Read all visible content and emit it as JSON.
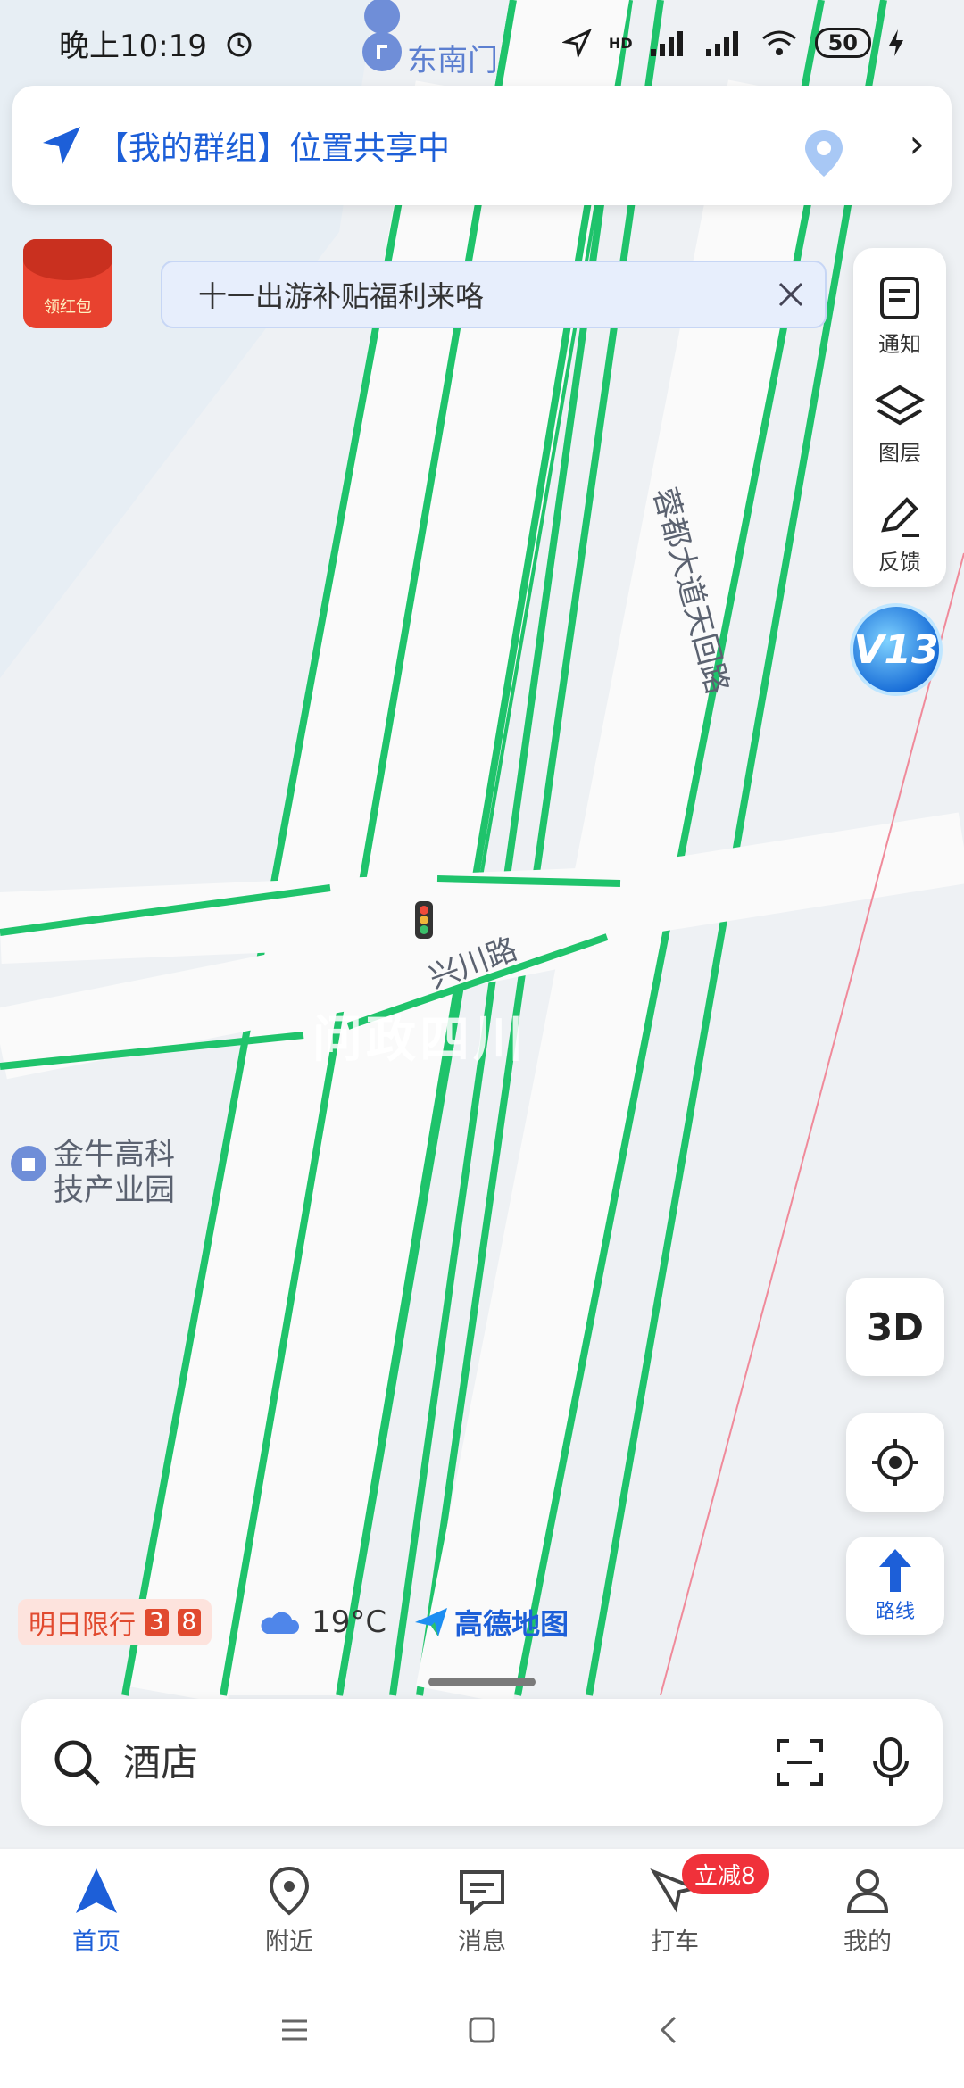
{
  "status_bar": {
    "time": "晚上10:19",
    "battery": "50",
    "network_label": "HD"
  },
  "map": {
    "labels": {
      "south_gate": "东南门",
      "road_rongdu": "蓉都大道天回路",
      "road_xingchuan": "兴川路",
      "poi_jinniu_line1": "金牛高科",
      "poi_jinniu_line2": "技产业园"
    },
    "watermark": "问政四川"
  },
  "group_banner": {
    "text": "【我的群组】位置共享中"
  },
  "red_packet": {
    "label": "领红包"
  },
  "promo": {
    "text": "十一出游补贴福利来咯"
  },
  "tools": {
    "notify": "通知",
    "layers": "图层",
    "feedback": "反馈"
  },
  "v13_badge": "V13",
  "fab": {
    "btn_3d": "3D",
    "route": "路线"
  },
  "info_row": {
    "restrict_label": "明日限行",
    "restrict_num1": "3",
    "restrict_num2": "8",
    "temperature": "19°C",
    "brand": "高德地图"
  },
  "search": {
    "placeholder": "酒店"
  },
  "nav": {
    "items": [
      {
        "label": "首页"
      },
      {
        "label": "附近"
      },
      {
        "label": "消息"
      },
      {
        "label": "打车"
      },
      {
        "label": "我的"
      }
    ],
    "badge": "立减8"
  },
  "colors": {
    "accent": "#1d5fd8",
    "road_edge": "#1fc36b",
    "promo_bg": "#e7eefc",
    "badge_red": "#f0313a"
  }
}
